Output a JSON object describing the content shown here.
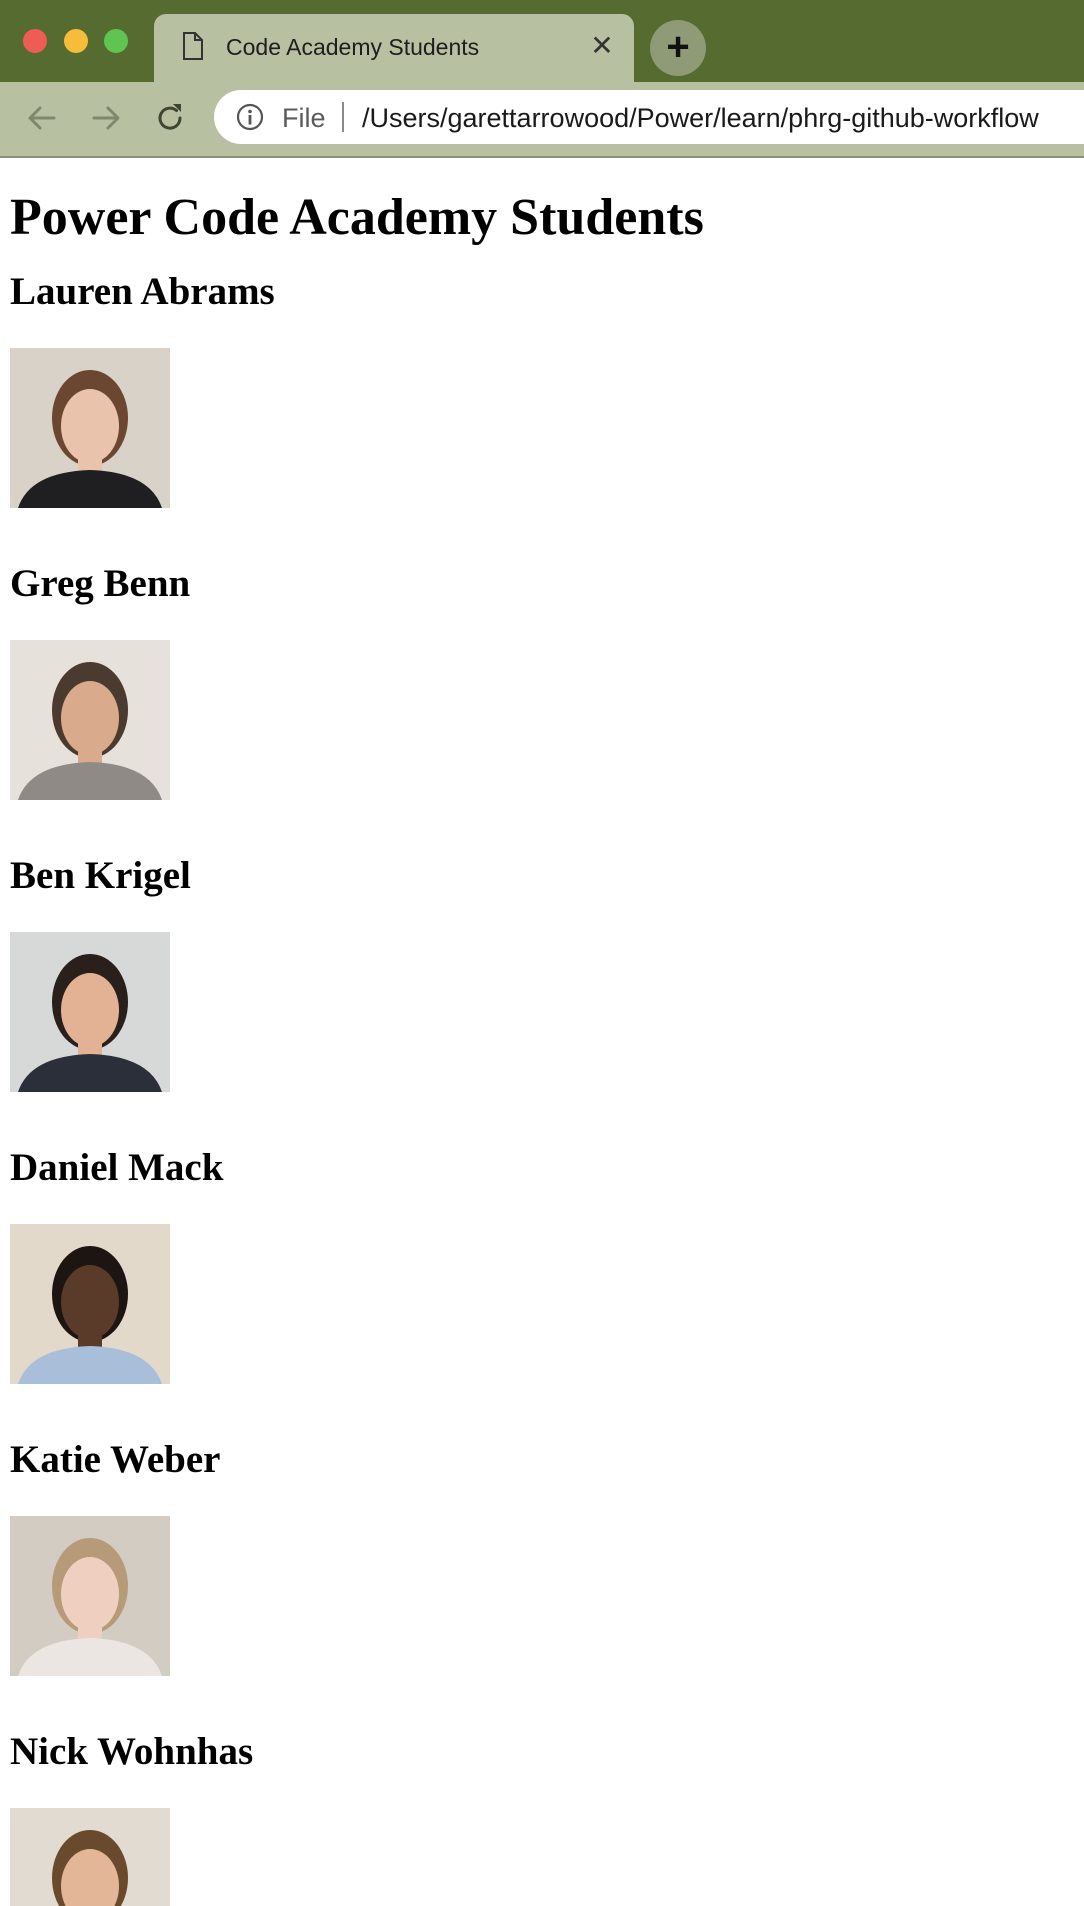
{
  "browser": {
    "tab_title": "Code Academy Students",
    "new_tab_label": "+",
    "close_label": "✕",
    "address": {
      "scheme": "File",
      "url": "/Users/garettarrowood/Power/learn/phrg-github-workflow"
    }
  },
  "page": {
    "title": "Power Code Academy Students",
    "students": [
      {
        "name": "Lauren Abrams",
        "bg": "#d9d2c8",
        "skin": "#e9c3ac",
        "hair": "#6b4630",
        "clothes": "#1f1f22"
      },
      {
        "name": "Greg Benn",
        "bg": "#e6e1da",
        "skin": "#d9ab8c",
        "hair": "#4a3a2f",
        "clothes": "#8f8a85"
      },
      {
        "name": "Ben Krigel",
        "bg": "#d7d9d9",
        "skin": "#e3b294",
        "hair": "#2a201b",
        "clothes": "#2b2f3a"
      },
      {
        "name": "Daniel Mack",
        "bg": "#e3d9cb",
        "skin": "#5a3a28",
        "hair": "#1c1511",
        "clothes": "#a9bfd9"
      },
      {
        "name": "Katie Weber",
        "bg": "#d3ccc3",
        "skin": "#efcfbf",
        "hair": "#b79a78",
        "clothes": "#ece6e2"
      },
      {
        "name": "Nick Wohnhas",
        "bg": "#e2dbd1",
        "skin": "#e2b697",
        "hair": "#6a4a2c",
        "clothes": "#bcc6d2"
      }
    ]
  }
}
